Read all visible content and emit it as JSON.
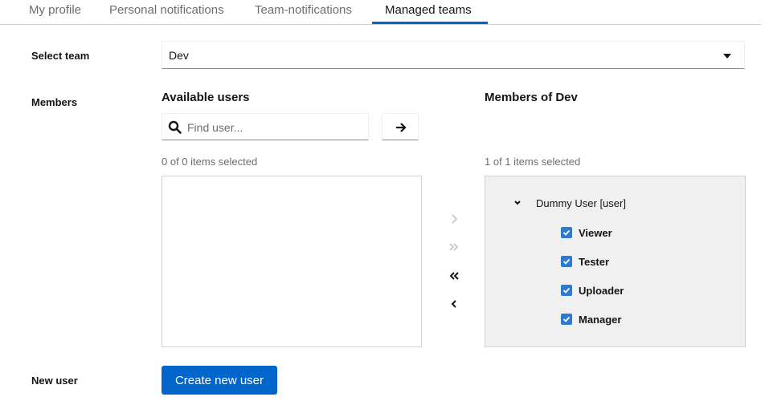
{
  "tabs": [
    {
      "label": "My profile"
    },
    {
      "label": "Personal notifications"
    },
    {
      "label": "Team-notifications"
    },
    {
      "label": "Managed teams"
    }
  ],
  "active_tab": "Managed teams",
  "select_team": {
    "label": "Select team",
    "value": "Dev"
  },
  "members": {
    "label": "Members",
    "available": {
      "title": "Available users",
      "search_placeholder": "Find user...",
      "count": "0 of 0 items selected",
      "items": []
    },
    "chosen": {
      "title": "Members of Dev",
      "count": "1 of 1 items selected",
      "user": "Dummy User [user]",
      "roles": [
        {
          "label": "Viewer",
          "checked": true
        },
        {
          "label": "Tester",
          "checked": true
        },
        {
          "label": "Uploader",
          "checked": true
        },
        {
          "label": "Manager",
          "checked": true
        }
      ]
    },
    "controls": [
      "add-selected-icon",
      "add-all-icon",
      "remove-all-icon",
      "remove-selected-icon"
    ]
  },
  "new_user": {
    "label": "New user",
    "button_label": "Create new user"
  },
  "colors": {
    "accent": "#0066cc",
    "checkbox": "#2b7bd6",
    "members_pane_bg": "#f0f0f0"
  }
}
